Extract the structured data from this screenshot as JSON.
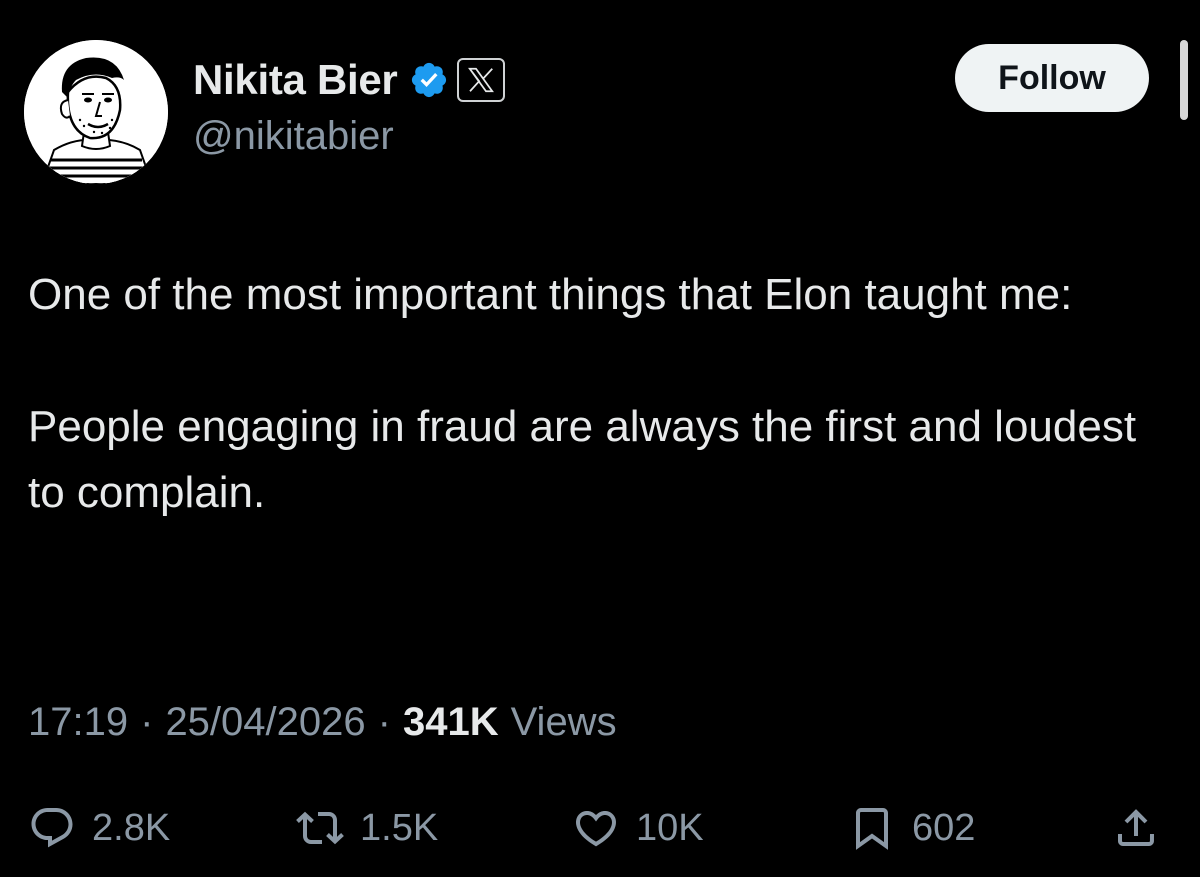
{
  "author": {
    "display_name": "Nikita Bier",
    "handle": "@nikitabier",
    "verified_icon": "verified-badge-icon",
    "affiliate_icon": "x-logo-icon",
    "avatar_icon": "sketch-portrait-avatar"
  },
  "follow_button": {
    "label": "Follow"
  },
  "tweet": {
    "paragraphs": [
      "One of the most important things that Elon taught me:",
      "People engaging in fraud are always the first and loudest to complain."
    ]
  },
  "meta": {
    "time": "17:19",
    "separator": "·",
    "date": "25/04/2026",
    "views_count": "341K",
    "views_label": "Views"
  },
  "actions": {
    "reply_count": "2.8K",
    "repost_count": "1.5K",
    "like_count": "10K",
    "bookmark_count": "602"
  },
  "colors": {
    "background": "#000000",
    "primary_text": "#e7e9ea",
    "secondary_text": "#8b98a5",
    "verified_blue": "#1d9bf0",
    "follow_bg": "#eff3f4"
  }
}
